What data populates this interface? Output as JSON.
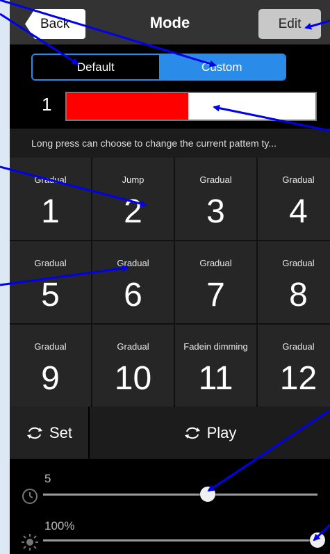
{
  "nav": {
    "back": "Back",
    "title": "Mode",
    "edit": "Edit"
  },
  "segments": {
    "default": "Default",
    "custom": "Custom",
    "selected": "custom"
  },
  "channel": {
    "number": "1",
    "level_fraction": 0.49,
    "color": "#ff0000"
  },
  "hint": "Long press can choose to change the current pattem ty...",
  "modes": [
    {
      "type": "Gradual",
      "num": "1"
    },
    {
      "type": "Jump",
      "num": "2"
    },
    {
      "type": "Gradual",
      "num": "3"
    },
    {
      "type": "Gradual",
      "num": "4"
    },
    {
      "type": "Gradual",
      "num": "5"
    },
    {
      "type": "Gradual",
      "num": "6"
    },
    {
      "type": "Gradual",
      "num": "7"
    },
    {
      "type": "Gradual",
      "num": "8"
    },
    {
      "type": "Gradual",
      "num": "9"
    },
    {
      "type": "Gradual",
      "num": "10"
    },
    {
      "type": "Fadein dimming",
      "num": "11"
    },
    {
      "type": "Gradual",
      "num": "12"
    }
  ],
  "controls": {
    "set": "Set",
    "play": "Play"
  },
  "sliders": {
    "speed": {
      "value_text": "5",
      "fraction": 0.6,
      "icon": "clock-icon"
    },
    "brightness": {
      "value_text": "100%",
      "fraction": 1.0,
      "icon": "sun-icon"
    }
  },
  "colors": {
    "accent": "#2b8be8",
    "annotation": "#0000ee"
  }
}
